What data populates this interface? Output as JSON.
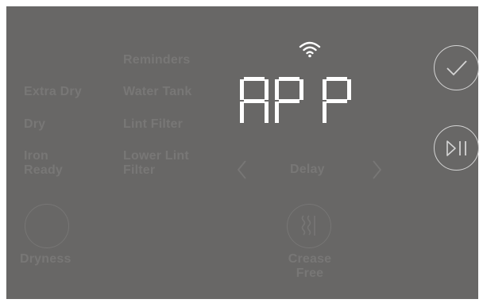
{
  "display": {
    "text": "APP",
    "wifi_icon": "wifi-icon",
    "color": "#ffffff"
  },
  "labels": {
    "reminders": "Reminders",
    "extra_dry": "Extra Dry",
    "water_tank": "Water Tank",
    "dry": "Dry",
    "lint_filter": "Lint Filter",
    "iron_ready": "Iron\nReady",
    "lower_lint_filter": "Lower Lint\nFilter",
    "delay": "Delay",
    "dryness": "Dryness",
    "crease_free": "Crease\nFree"
  },
  "icons": {
    "confirm": "check-icon",
    "start_pause": "play-pause-icon",
    "prev": "chevron-left-icon",
    "next": "chevron-right-icon",
    "crease": "wavy-lines-icon"
  },
  "colors": {
    "panel": "#686766",
    "dim_text": "#787776",
    "active": "#ffffff",
    "button_ring": "#d4d4d4"
  }
}
